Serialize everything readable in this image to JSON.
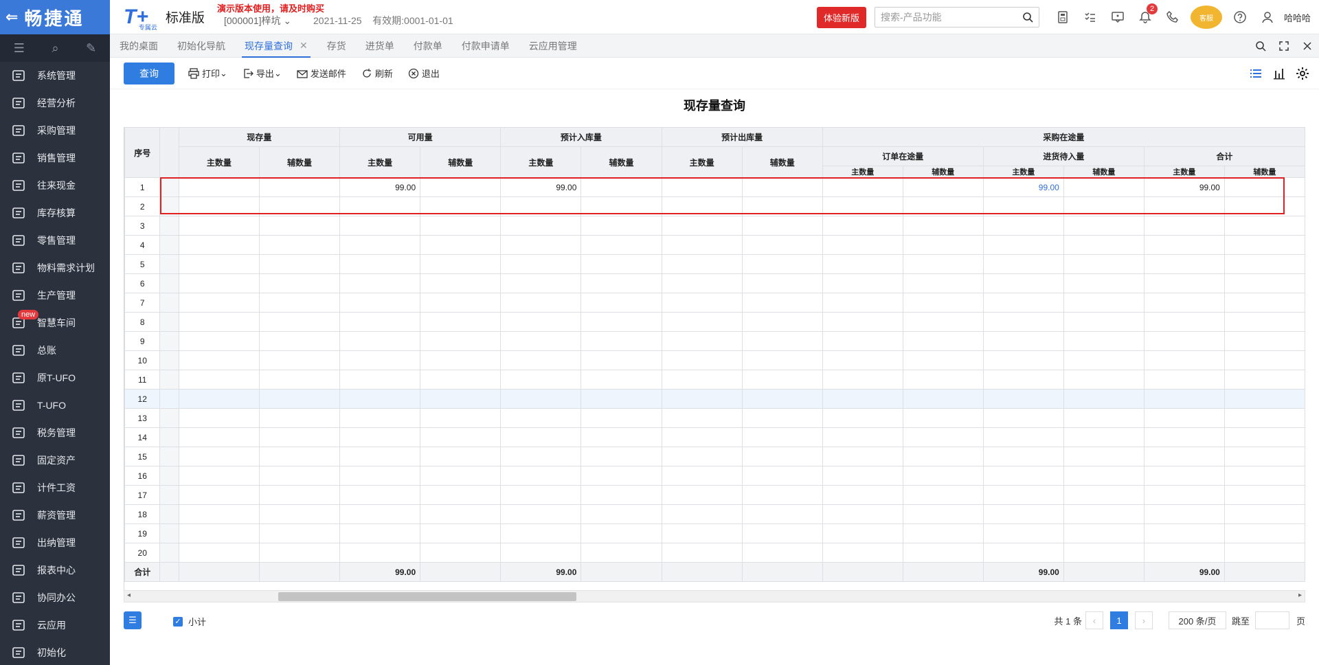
{
  "brand": {
    "back": "⇐",
    "name": "畅捷通"
  },
  "sidebar": {
    "items": [
      {
        "label": "系统管理",
        "icon": "code-monitor-icon"
      },
      {
        "label": "经营分析",
        "icon": "presentation-chart-icon"
      },
      {
        "label": "采购管理",
        "icon": "cart-icon"
      },
      {
        "label": "销售管理",
        "icon": "growth-chart-icon"
      },
      {
        "label": "往来现金",
        "icon": "exchange-icon"
      },
      {
        "label": "库存核算",
        "icon": "warehouse-icon"
      },
      {
        "label": "零售管理",
        "icon": "store-icon"
      },
      {
        "label": "物料需求计划",
        "icon": "cube-icon"
      },
      {
        "label": "生产管理",
        "icon": "sliders-icon"
      },
      {
        "label": "智慧车间",
        "icon": "workshop-icon",
        "badge": "new"
      },
      {
        "label": "总账",
        "icon": "ledger-icon"
      },
      {
        "label": "原T-UFO",
        "icon": "ufo-icon"
      },
      {
        "label": "T-UFO",
        "icon": "building-icon"
      },
      {
        "label": "税务管理",
        "icon": "tax-icon"
      },
      {
        "label": "固定资产",
        "icon": "bank-icon"
      },
      {
        "label": "计件工资",
        "icon": "piecework-icon"
      },
      {
        "label": "薪资管理",
        "icon": "salary-icon"
      },
      {
        "label": "出纳管理",
        "icon": "cashier-icon"
      },
      {
        "label": "报表中心",
        "icon": "pie-chart-icon"
      },
      {
        "label": "协同办公",
        "icon": "collab-icon"
      },
      {
        "label": "云应用",
        "icon": "cloud-icon"
      },
      {
        "label": "初始化",
        "icon": "init-icon"
      }
    ]
  },
  "header": {
    "logo": "T+",
    "logo_sub": "专属云",
    "edition": "标准版",
    "demo_note": "演示版本使用，请及时购买",
    "company": "[000001]梓坑",
    "date": "2021-11-25",
    "validity": "有效期:0001-01-01",
    "try_button": "体验新版",
    "search_placeholder": "搜索-产品功能",
    "notif_count": "2",
    "mascot_text": "客服",
    "username": "哈哈哈"
  },
  "tabs": [
    {
      "label": "我的桌面",
      "active": false
    },
    {
      "label": "初始化导航",
      "active": false
    },
    {
      "label": "现存量查询",
      "active": true,
      "close": "✕"
    },
    {
      "label": "存货",
      "active": false
    },
    {
      "label": "进货单",
      "active": false
    },
    {
      "label": "付款单",
      "active": false
    },
    {
      "label": "付款申请单",
      "active": false
    },
    {
      "label": "云应用管理",
      "active": false
    }
  ],
  "toolbar": {
    "query": "查询",
    "print": "打印",
    "export": "导出",
    "email": "发送邮件",
    "refresh": "刷新",
    "exit": "退出"
  },
  "report": {
    "title": "现存量查询",
    "headers": {
      "seq": "序号",
      "on_hand": "现存量",
      "available": "可用量",
      "expected_in": "预计入库量",
      "expected_out": "预计出库量",
      "purchase_transit": "采购在途量",
      "order_transit": "订单在途量",
      "pending_in": "进货待入量",
      "total": "合计",
      "main_qty": "主数量",
      "aux_qty": "辅数量"
    },
    "rows": [
      {
        "seq": "1",
        "cells": [
          "",
          "",
          "99.00",
          "",
          "99.00",
          "",
          "",
          "",
          "",
          "",
          "99.00",
          "",
          "99.00",
          ""
        ]
      },
      {
        "seq": "2",
        "cells": [
          "",
          "",
          "",
          "",
          "",
          "",
          "",
          "",
          "",
          "",
          "",
          "",
          "",
          ""
        ]
      },
      {
        "seq": "3",
        "cells": [
          "",
          "",
          "",
          "",
          "",
          "",
          "",
          "",
          "",
          "",
          "",
          "",
          "",
          ""
        ]
      },
      {
        "seq": "4",
        "cells": [
          "",
          "",
          "",
          "",
          "",
          "",
          "",
          "",
          "",
          "",
          "",
          "",
          "",
          ""
        ]
      },
      {
        "seq": "5",
        "cells": [
          "",
          "",
          "",
          "",
          "",
          "",
          "",
          "",
          "",
          "",
          "",
          "",
          "",
          ""
        ]
      },
      {
        "seq": "6",
        "cells": [
          "",
          "",
          "",
          "",
          "",
          "",
          "",
          "",
          "",
          "",
          "",
          "",
          "",
          ""
        ]
      },
      {
        "seq": "7",
        "cells": [
          "",
          "",
          "",
          "",
          "",
          "",
          "",
          "",
          "",
          "",
          "",
          "",
          "",
          ""
        ]
      },
      {
        "seq": "8",
        "cells": [
          "",
          "",
          "",
          "",
          "",
          "",
          "",
          "",
          "",
          "",
          "",
          "",
          "",
          ""
        ]
      },
      {
        "seq": "9",
        "cells": [
          "",
          "",
          "",
          "",
          "",
          "",
          "",
          "",
          "",
          "",
          "",
          "",
          "",
          ""
        ]
      },
      {
        "seq": "10",
        "cells": [
          "",
          "",
          "",
          "",
          "",
          "",
          "",
          "",
          "",
          "",
          "",
          "",
          "",
          ""
        ]
      },
      {
        "seq": "11",
        "cells": [
          "",
          "",
          "",
          "",
          "",
          "",
          "",
          "",
          "",
          "",
          "",
          "",
          "",
          ""
        ]
      },
      {
        "seq": "12",
        "cells": [
          "",
          "",
          "",
          "",
          "",
          "",
          "",
          "",
          "",
          "",
          "",
          "",
          "",
          ""
        ]
      },
      {
        "seq": "13",
        "cells": [
          "",
          "",
          "",
          "",
          "",
          "",
          "",
          "",
          "",
          "",
          "",
          "",
          "",
          ""
        ]
      },
      {
        "seq": "14",
        "cells": [
          "",
          "",
          "",
          "",
          "",
          "",
          "",
          "",
          "",
          "",
          "",
          "",
          "",
          ""
        ]
      },
      {
        "seq": "15",
        "cells": [
          "",
          "",
          "",
          "",
          "",
          "",
          "",
          "",
          "",
          "",
          "",
          "",
          "",
          ""
        ]
      },
      {
        "seq": "16",
        "cells": [
          "",
          "",
          "",
          "",
          "",
          "",
          "",
          "",
          "",
          "",
          "",
          "",
          "",
          ""
        ]
      },
      {
        "seq": "17",
        "cells": [
          "",
          "",
          "",
          "",
          "",
          "",
          "",
          "",
          "",
          "",
          "",
          "",
          "",
          ""
        ]
      },
      {
        "seq": "18",
        "cells": [
          "",
          "",
          "",
          "",
          "",
          "",
          "",
          "",
          "",
          "",
          "",
          "",
          "",
          ""
        ]
      },
      {
        "seq": "19",
        "cells": [
          "",
          "",
          "",
          "",
          "",
          "",
          "",
          "",
          "",
          "",
          "",
          "",
          "",
          ""
        ]
      },
      {
        "seq": "20",
        "cells": [
          "",
          "",
          "",
          "",
          "",
          "",
          "",
          "",
          "",
          "",
          "",
          "",
          "",
          ""
        ]
      }
    ],
    "total_row": {
      "label": "合计",
      "cells": [
        "",
        "",
        "99.00",
        "",
        "99.00",
        "",
        "",
        "",
        "",
        "",
        "99.00",
        "",
        "99.00",
        ""
      ]
    }
  },
  "footer": {
    "subtotal_label": "小计",
    "count_text": "共 1 条",
    "prev": "‹",
    "current_page": "1",
    "next": "›",
    "page_size": "200 条/页",
    "jump_label": "跳至",
    "page_unit": "页"
  },
  "colors": {
    "accent": "#2f7de1",
    "sidebar": "#2b313d",
    "brand": "#3b79d8",
    "alert": "#e02020"
  }
}
